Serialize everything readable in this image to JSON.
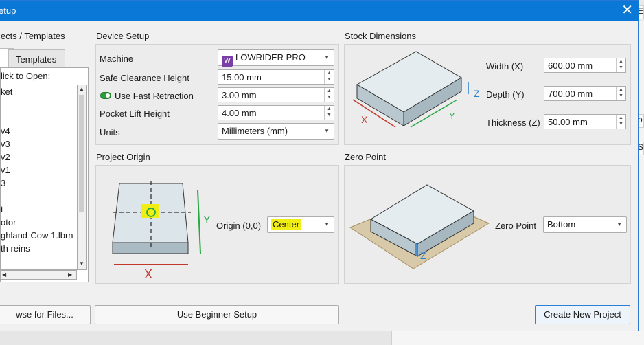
{
  "window": {
    "title": "etup",
    "close_glyph": "✕"
  },
  "sections": {
    "projects": "jects / Templates",
    "device_setup": "Device Setup",
    "stock_dimensions": "Stock Dimensions",
    "project_origin": "Project Origin",
    "zero_point": "Zero Point"
  },
  "templates_panel": {
    "tab_templates": "Templates",
    "list_header": "lick to Open:",
    "items": [
      "ket",
      "",
      "",
      "v4",
      "v3",
      "v2",
      "v1",
      "3",
      "",
      "t",
      "otor",
      "ghland-Cow 1.lbrn",
      "th reins"
    ]
  },
  "device_setup": {
    "machine_label": "Machine",
    "machine_value": "LOWRIDER PRO",
    "safe_clearance_label": "Safe Clearance Height",
    "safe_clearance_value": "15.00 mm",
    "fast_retraction_label": "Use Fast Retraction",
    "fast_retraction_value": "3.00 mm",
    "pocket_lift_label": "Pocket Lift Height",
    "pocket_lift_value": "4.00 mm",
    "units_label": "Units",
    "units_value": "Millimeters (mm)"
  },
  "stock": {
    "width_label": "Width (X)",
    "width_value": "600.00 mm",
    "depth_label": "Depth (Y)",
    "depth_value": "700.00 mm",
    "thickness_label": "Thickness (Z)",
    "thickness_value": "50.00 mm",
    "axis_x": "X",
    "axis_y": "Y",
    "axis_z": "Z"
  },
  "origin": {
    "label": "Origin (0,0)",
    "value": "Center",
    "axis_x": "X",
    "axis_y": "Y"
  },
  "zero": {
    "label": "Zero Point",
    "value": "Bottom",
    "axis_z": "Z"
  },
  "buttons": {
    "browse": "wse for Files...",
    "beginner": "Use Beginner Setup",
    "create": "Create New Project"
  },
  "bg_fragments": [
    "E",
    "o",
    "Sh"
  ],
  "colors": {
    "titlebar": "#0a78d7",
    "axis_x": "#c0392b",
    "axis_y": "#27a844",
    "axis_z": "#2a7fd0",
    "highlight": "#f0ee15"
  }
}
